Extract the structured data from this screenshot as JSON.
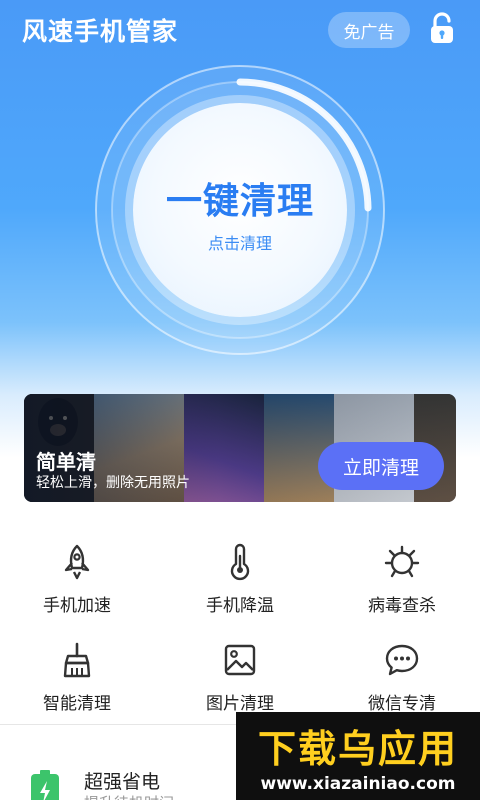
{
  "header": {
    "app_title": "风速手机管家",
    "noad_label": "免广告",
    "lock_icon": "lock-open-icon"
  },
  "cleaner": {
    "title": "一键清理",
    "subtitle": "点击清理"
  },
  "banner": {
    "title": "简单清",
    "subtitle": "轻松上滑，删除无用照片",
    "button_label": "立即清理"
  },
  "features": [
    {
      "label": "手机加速",
      "icon": "rocket-icon"
    },
    {
      "label": "手机降温",
      "icon": "thermometer-icon"
    },
    {
      "label": "病毒查杀",
      "icon": "virus-icon"
    },
    {
      "label": "智能清理",
      "icon": "broom-icon"
    },
    {
      "label": "图片清理",
      "icon": "image-icon"
    },
    {
      "label": "微信专清",
      "icon": "chat-icon"
    }
  ],
  "power": {
    "title": "超强省电",
    "subtitle": "提升待机时间"
  },
  "watermark": {
    "title": "下载乌应用",
    "url": "www.xiazainiao.com"
  },
  "colors": {
    "accent": "#2a7df2",
    "button": "#5b70f6",
    "icon_stroke": "#333333"
  }
}
